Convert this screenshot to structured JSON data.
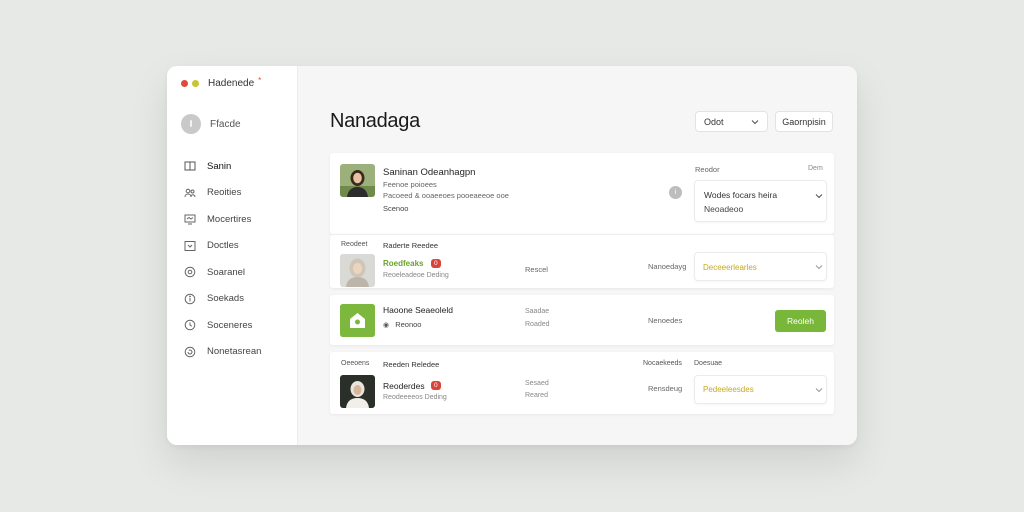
{
  "app": {
    "brand": "Hadenede",
    "brand_mark": "*"
  },
  "profile": {
    "name": "Ffacde"
  },
  "sidebar": {
    "items": [
      {
        "label": "Sanin",
        "icon": "book-icon",
        "active": true
      },
      {
        "label": "Reoities",
        "icon": "users-icon"
      },
      {
        "label": "Mocertires",
        "icon": "monitor-icon"
      },
      {
        "label": "Doctles",
        "icon": "download-box-icon"
      },
      {
        "label": "Soaranel",
        "icon": "settings-circle-icon"
      },
      {
        "label": "Soekads",
        "icon": "info-circle-icon"
      },
      {
        "label": "Soceneres",
        "icon": "clock-circle-icon"
      },
      {
        "label": "Nonetasrean",
        "icon": "refresh-circle-icon"
      }
    ]
  },
  "main": {
    "title": "Nanadaga",
    "select_label": "Odot",
    "top_button_label": "Gaornpisin"
  },
  "card1": {
    "name": "Saninan Odeanhagpn",
    "sub": "Feenoe poioees",
    "desc": "Pacoeed & ooaeeoes pooeaeeoe ooe",
    "meta": "Scenoo",
    "info_icon": "i",
    "right_label": "Reodor",
    "right_label2": "Dem",
    "dropdown_line1": "Wodes focars heira",
    "dropdown_line2": "Neoadeoo"
  },
  "card2": {
    "header_left": "Reodeet",
    "header_title": "Raderte Reedee",
    "name": "Roedfeaks",
    "badge": "0",
    "meta": "Reoeleadeoe Deding",
    "col_label": "Rescel",
    "status": "Nanoedayg",
    "dropdown_value": "Deceeerlearles"
  },
  "card3": {
    "title": "Haoone Seaeoleld",
    "meta": "Reonoo",
    "col_label": "Saadae",
    "col_label2": "Roaded",
    "status": "Nenoedes",
    "button": "Reoleh"
  },
  "card4": {
    "header_left": "Oeeoens",
    "header_title": "Reeden Reledee",
    "header_right1": "Nocaekeeds",
    "header_right2": "Doesuae",
    "name": "Reoderdes",
    "badge": "0",
    "meta": "Reodeeeeos Deding",
    "col_label": "Sesaed",
    "col_label2": "Reared",
    "status": "Rensdeug",
    "dropdown_value": "Pedeeleesdes"
  },
  "colors": {
    "accent_green": "#79b73a",
    "badge_red": "#d8443a",
    "highlight_yellow": "#c9a81e"
  }
}
